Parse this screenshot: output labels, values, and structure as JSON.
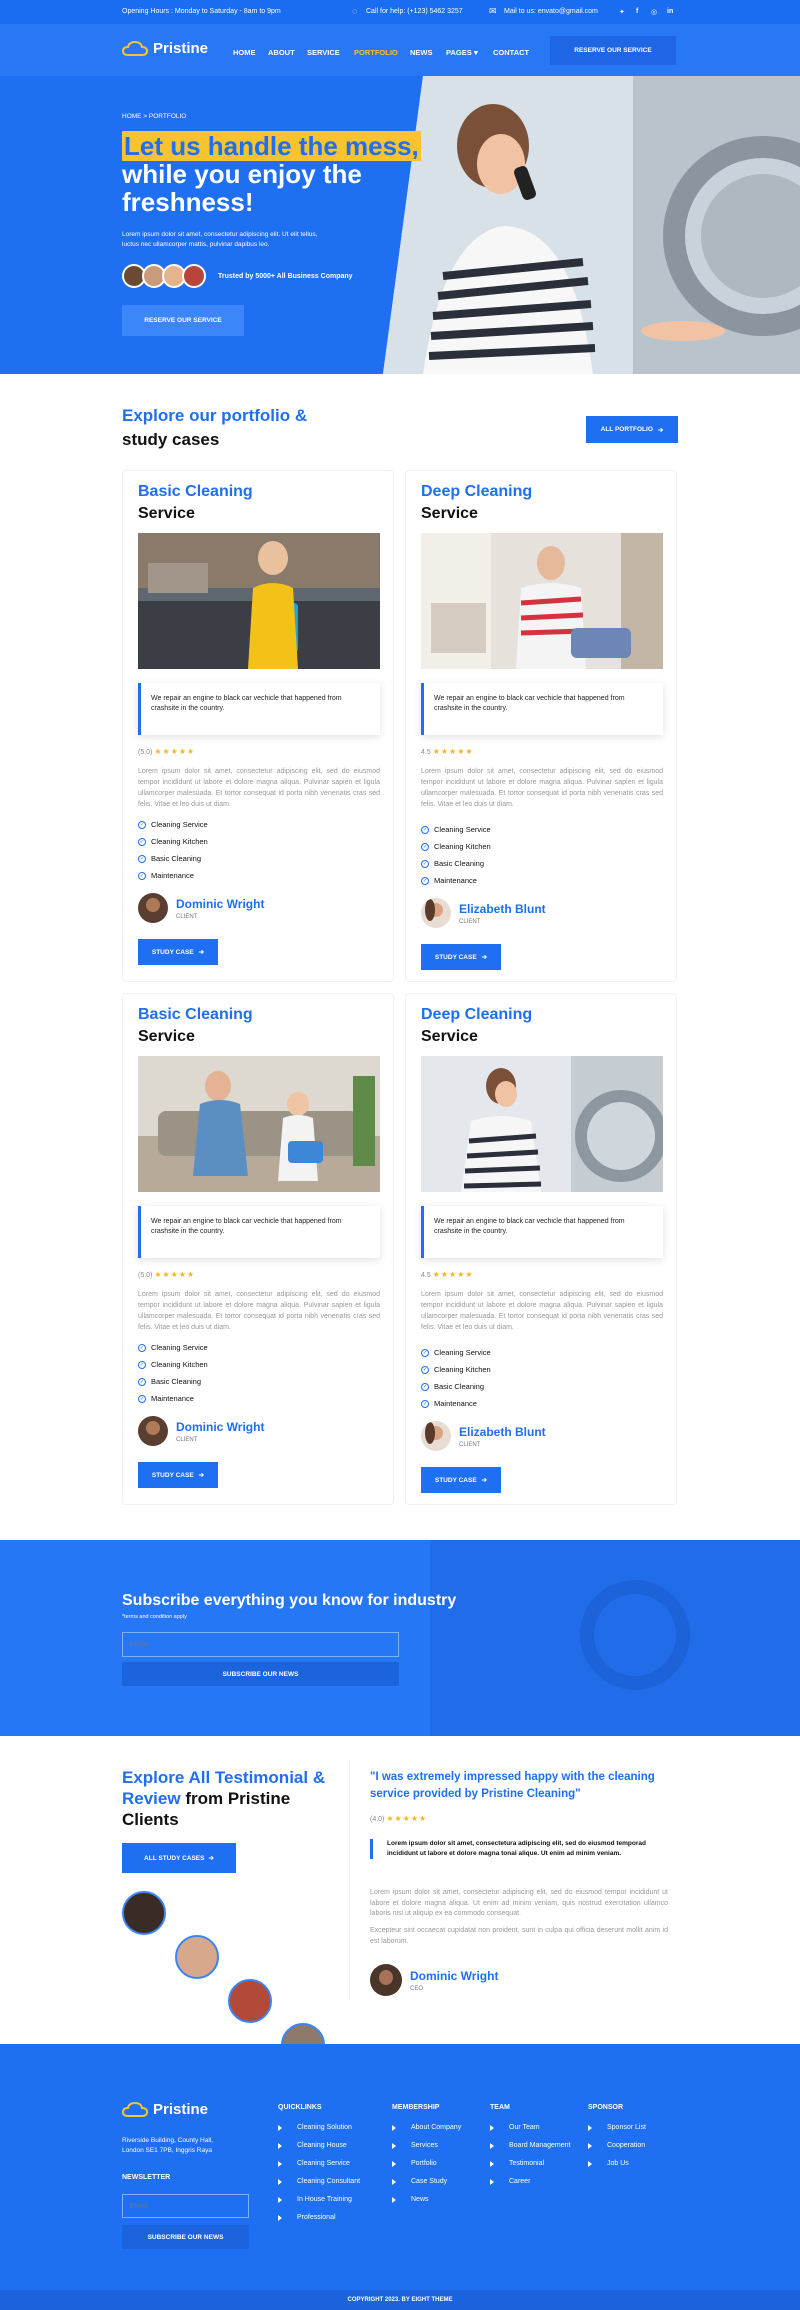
{
  "topbar": {
    "hours": "Opening Hours : Monday to Saturday - 8am to 9pm",
    "help": "Call for help: (+123) 5462 3257",
    "mail": "Mail to us: envato@gmail.com",
    "socials": [
      "twitter-icon",
      "facebook-icon",
      "instagram-icon",
      "linkedin-icon"
    ]
  },
  "nav": {
    "brand": "Pristine",
    "items": [
      "HOME",
      "ABOUT",
      "SERVICE",
      "PORTFOLIO",
      "NEWS",
      "PAGES",
      "CONTACT"
    ],
    "active": "PORTFOLIO",
    "cta": "RESERVE OUR SERVICE"
  },
  "hero": {
    "breadcrumb": "HOME > PORTFOLIO",
    "title_highlight": "Let us handle the mess,",
    "title_rest_1": "while you enjoy the",
    "title_rest_2": "freshness!",
    "desc_1": "Lorem ipsum dolor sit amet, consectetur adipiscing elit. Ut elit tellus,",
    "desc_2": "luctus nec ullamcorper mattis, pulvinar dapibus leo.",
    "trusted": "Trusted by 5000+ All Business Company",
    "cta": "RESERVE OUR SERVICE"
  },
  "portfolio": {
    "heading_1": "Explore our portfolio &",
    "heading_2": "study cases",
    "all_button": "ALL PORTFOLIO",
    "cards": [
      {
        "title_1": "Basic Cleaning",
        "title_2": "Service",
        "quote": "We repair an engine to black car vechicle that happened from crashsite in the country.",
        "rating": "(5.0)",
        "stars": "★★★★★",
        "body": "Lorem ipsum dolor sit amet, consectetur adipiscing elit, sed do eiusmod tempor incididunt ut labore et dolore magna aliqua. Pulvinar sapien et ligula ullamcorper malesuada. Et tortor consequat id porta nibh venenatis cras sed felis. Vitae et leo duis ut diam.",
        "features": [
          "Cleaning Service",
          "Cleaning Kitchen",
          "Basic Cleaning",
          "Maintenance"
        ],
        "person": "Dominic Wright",
        "role": "CLIENT",
        "button": "STUDY CASE"
      },
      {
        "title_1": "Deep Cleaning",
        "title_2": "Service",
        "quote": "We repair an engine to black car vechicle that happened from crashsite in the country.",
        "rating": "4.5",
        "stars": "★★★★★",
        "body": "Lorem ipsum dolor sit amet, consectetur adipiscing elit, sed do eiusmod tempor incididunt ut labore et dolore magna aliqua. Pulvinar sapien et ligula ullamcorper malesuada. Et tortor consequat id porta nibh venenatis cras sed felis. Vitae et leo duis ut diam.",
        "features": [
          "Cleaning Service",
          "Cleaning Kitchen",
          "Basic Cleaning",
          "Maintenance"
        ],
        "person": "Elizabeth Blunt",
        "role": "CLIENT",
        "button": "STUDY CASE"
      },
      {
        "title_1": "Basic Cleaning",
        "title_2": "Service",
        "quote": "We repair an engine to black car vechicle that happened from crashsite in the country.",
        "rating": "(5.0)",
        "stars": "★★★★★",
        "body": "Lorem ipsum dolor sit amet, consectetur adipiscing elit, sed do eiusmod tempor incididunt ut labore et dolore magna aliqua. Pulvinar sapien et ligula ullamcorper malesuada. Et tortor consequat id porta nibh venenatis cras sed felis. Vitae et leo duis ut diam.",
        "features": [
          "Cleaning Service",
          "Cleaning Kitchen",
          "Basic Cleaning",
          "Maintenance"
        ],
        "person": "Dominic Wright",
        "role": "CLIENT",
        "button": "STUDY CASE"
      },
      {
        "title_1": "Deep Cleaning",
        "title_2": "Service",
        "quote": "We repair an engine to black car vechicle that happened from crashsite in the country.",
        "rating": "4.5",
        "stars": "★★★★★",
        "body": "Lorem ipsum dolor sit amet, consectetur adipiscing elit, sed do eiusmod tempor incididunt ut labore et dolore magna aliqua. Pulvinar sapien et ligula ullamcorper malesuada. Et tortor consequat id porta nibh venenatis cras sed felis. Vitae et leo duis ut diam.",
        "features": [
          "Cleaning Service",
          "Cleaning Kitchen",
          "Basic Cleaning",
          "Maintenance"
        ],
        "person": "Elizabeth Blunt",
        "role": "CLIENT",
        "button": "STUDY CASE"
      }
    ]
  },
  "subscribe": {
    "title": "Subscribe everything you know for industry",
    "terms": "*terms and condition apply",
    "placeholder": "EMAIL",
    "button": "SUBSCRIBE OUR NEWS"
  },
  "testimonial": {
    "h_blue": "Explore All Testimonial &",
    "h_blue2": "Review",
    "h_dark": "from Pristine",
    "h_dark2": "Clients",
    "button": "ALL STUDY CASES",
    "quote": "\"I was extremely impressed happy with the cleaning service provided by Pristine Cleaning\"",
    "rating": "(4.0)",
    "stars": "★★★★★",
    "bold": "Lorem ipsum dolor sit amet, consectetura adipiscing elit, sed do eiusmod temporad incididunt ut labore et dolore magna tonal alique. Ut enim ad minim veniam.",
    "body_1": "Lorem ipsum dolor sit amet, consectetur adipiscing elit, sed do eiusmod tempor incididunt ut labore et dolore magna aliqua. Ut enim ad minim veniam, quis nostrud exercitation ullamco laboris nisi ut aliquip ex ea commodo consequat.",
    "body_2": "Excepteur sint occaecat cupidatat non proident, sunt in culpa qui officia deserunt mollit anim id est laborum.",
    "person": "Dominic Wright",
    "role": "CEO"
  },
  "footer": {
    "brand": "Pristine",
    "address_1": "Riverside Building, County Hall,",
    "address_2": "London SE1 7PB, Inggris Raya",
    "newsletter": "NEWSLETTER",
    "placeholder": "EMAIL",
    "button": "SUBSCRIBE OUR NEWS",
    "cols": [
      {
        "title": "QUICKLINKS",
        "items": [
          "Cleaning Solution",
          "Cleaning House",
          "Cleaning Service",
          "Cleaning Consultant",
          "In House Training",
          "Professional"
        ]
      },
      {
        "title": "MEMBERSHIP",
        "items": [
          "About Company",
          "Services",
          "Portfolio",
          "Case Study",
          "News"
        ]
      },
      {
        "title": "TEAM",
        "items": [
          "Our Team",
          "Board Management",
          "Testimonial",
          "Career"
        ]
      },
      {
        "title": "SPONSOR",
        "items": [
          "Sponsor List",
          "Cooperation",
          "Job Us"
        ]
      }
    ],
    "copyright": "COPYRIGHT 2023. BY EIGHT THEME"
  },
  "colors": {
    "primary": "#1e6ff1",
    "accent": "#f7c32e",
    "star": "#f5b520"
  }
}
